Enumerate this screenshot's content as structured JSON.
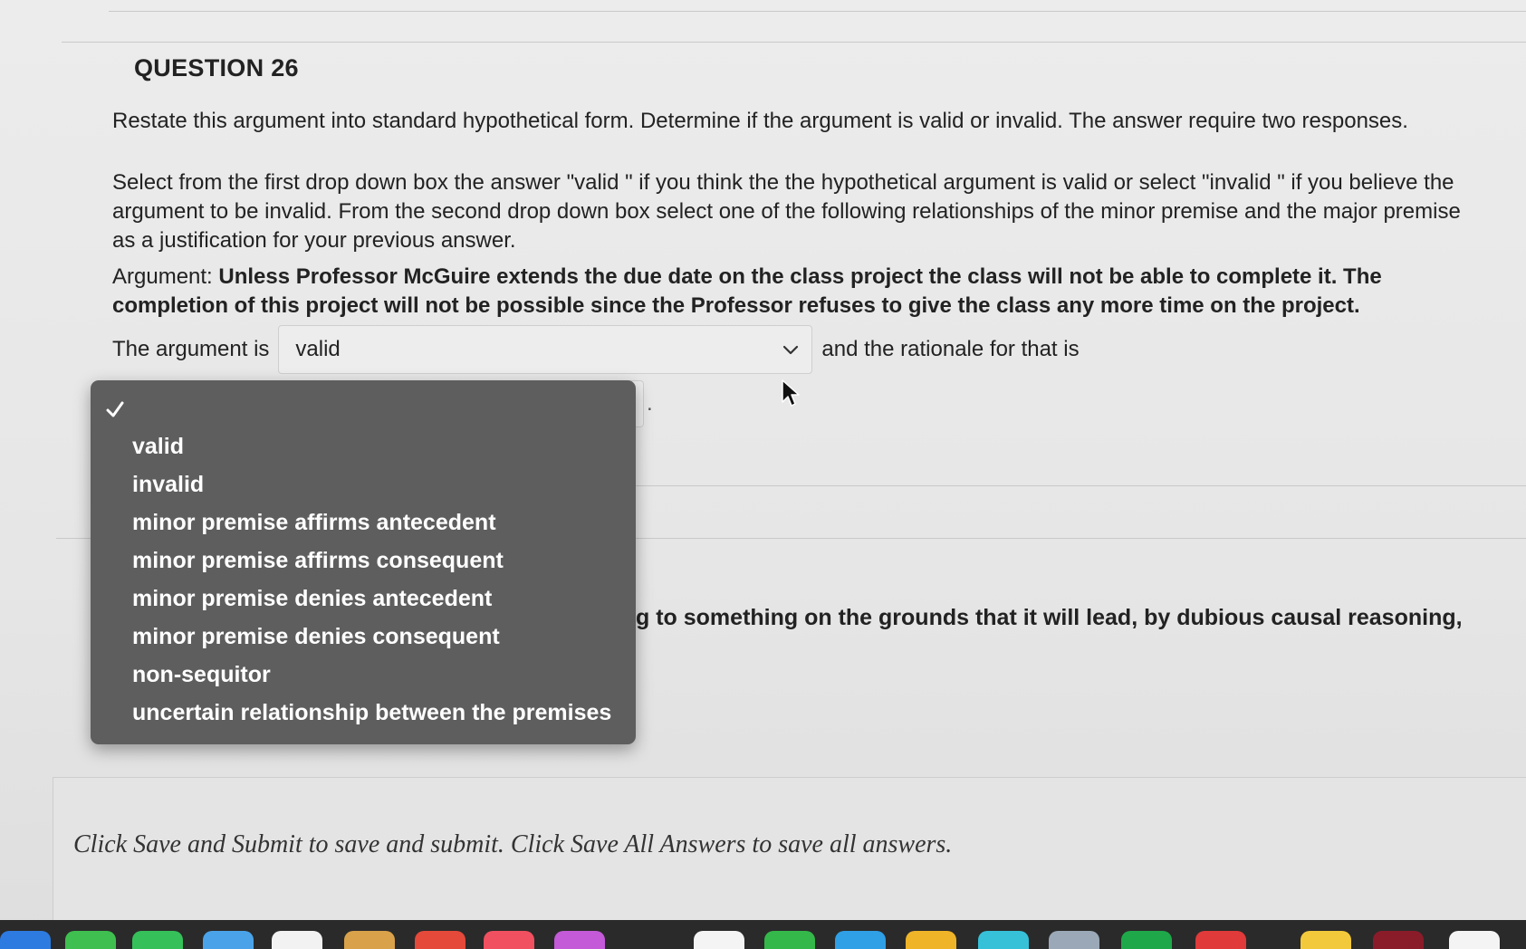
{
  "question": {
    "title": "QUESTION 26",
    "paragraph_1": "Restate this argument into standard hypothetical form. Determine if the argument is valid or invalid.  The answer require two responses.",
    "paragraph_2": "Select from the first drop down box the answer \"valid \" if you think the the hypothetical argument is valid or select \"invalid \" if you believe the argument to be invalid.  From the second drop down box select one of the following relationships of the minor premise and the major premise as a justification for your previous answer.",
    "argument_prefix": "Argument: ",
    "argument_text": "Unless Professor McGuire extends the due date on the class project  the class will not be able to complete it.  The completion of this project will not be possible since the Professor refuses to give the class any more time on the project.",
    "sentence_start": "The argument is",
    "sentence_middle": "and the rationale for that is",
    "sentence_end": "."
  },
  "select_1": {
    "selected_value": "valid"
  },
  "dropdown_menu": {
    "options": [
      "valid",
      "invalid",
      "minor premise affirms antecedent",
      "minor premise affirms consequent",
      "minor premise denies antecedent",
      "minor premise denies consequent",
      "non-sequitor",
      "uncertain relationship between the premises"
    ]
  },
  "partially_hidden_text": "g to something on the grounds that it will lead, by dubious causal reasoning,",
  "footer": {
    "instructions": "Click Save and Submit to save and submit. Click Save All Answers to save all answers."
  },
  "icons": {
    "checkmark": "checkmark-icon",
    "chevron": "chevron-down-icon",
    "cursor": "mouse-pointer-icon"
  },
  "colors": {
    "menu_background": "#5e5e5e",
    "menu_text": "#ffffff",
    "page_background": "#e9e9e9"
  }
}
